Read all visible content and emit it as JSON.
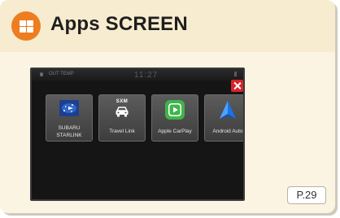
{
  "header": {
    "title": "Apps SCREEN",
    "icon": "apps-grid-icon",
    "icon_color": "#ee7d1f"
  },
  "screen": {
    "status_bar": {
      "out_temp_label": "OUT TEMP",
      "clock": "11:27"
    },
    "close_icon": "close-icon",
    "close_color": "#d6242a",
    "apps": [
      {
        "label_lines": [
          "SUBARU",
          "STARLINK"
        ],
        "icon": "subaru-starlink-icon"
      },
      {
        "label_lines": [
          "Travel Link"
        ],
        "icon": "sxm-travel-link-icon",
        "icon_text": "SXM"
      },
      {
        "label_lines": [
          "Apple CarPlay"
        ],
        "icon": "apple-carplay-icon"
      },
      {
        "label_lines": [
          "Android Auto"
        ],
        "icon": "android-auto-icon"
      }
    ]
  },
  "page_reference": "P.29",
  "colors": {
    "card_background": "#fbf4e3",
    "header_background": "#f7eccf",
    "screen_background": "#151515"
  }
}
